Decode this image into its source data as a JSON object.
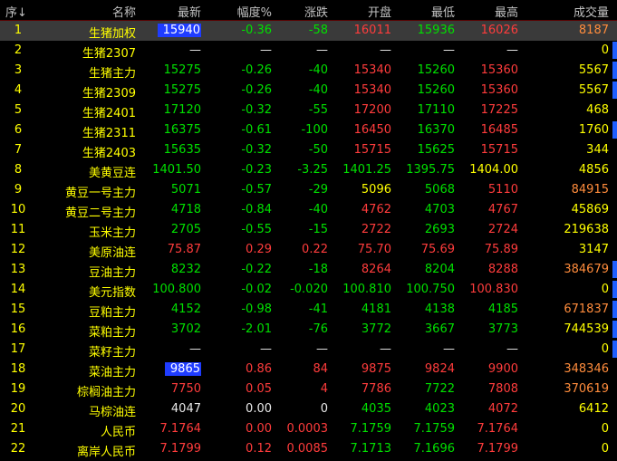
{
  "header": {
    "idx": "序",
    "sort_arrow": "↓",
    "name": "名称",
    "last": "最新",
    "pct": "幅度%",
    "chg": "涨跌",
    "open": "开盘",
    "low": "最低",
    "high": "最高",
    "vol": "成交量"
  },
  "colors": {
    "up": "#ff3c3c",
    "down": "#00e000",
    "flat": "#e8e8e8",
    "name": "#ffff00",
    "highlight": "#1f3cff",
    "bar": "#1f5fff"
  },
  "rows": [
    {
      "idx": "1",
      "name": "生猪加权",
      "last": "15940",
      "pct": "-0.36",
      "chg": "-58",
      "open": "16011",
      "low": "15936",
      "high": "16026",
      "vol": "8187",
      "last_c": "w",
      "pct_c": "g",
      "chg_c": "g",
      "open_c": "r",
      "low_c": "g",
      "high_c": "r",
      "vol_c": "o",
      "sel": true,
      "hl": true,
      "bar": false
    },
    {
      "idx": "2",
      "name": "生猪2307",
      "last": "—",
      "pct": "—",
      "chg": "—",
      "open": "—",
      "low": "—",
      "high": "—",
      "vol": "0",
      "last_c": "w",
      "pct_c": "w",
      "chg_c": "w",
      "open_c": "w",
      "low_c": "w",
      "high_c": "w",
      "vol_c": "y",
      "bar": true
    },
    {
      "idx": "3",
      "name": "生猪主力",
      "last": "15275",
      "pct": "-0.26",
      "chg": "-40",
      "open": "15340",
      "low": "15260",
      "high": "15360",
      "vol": "5567",
      "last_c": "g",
      "pct_c": "g",
      "chg_c": "g",
      "open_c": "r",
      "low_c": "g",
      "high_c": "r",
      "vol_c": "y",
      "bar": true
    },
    {
      "idx": "4",
      "name": "生猪2309",
      "last": "15275",
      "pct": "-0.26",
      "chg": "-40",
      "open": "15340",
      "low": "15260",
      "high": "15360",
      "vol": "5567",
      "last_c": "g",
      "pct_c": "g",
      "chg_c": "g",
      "open_c": "r",
      "low_c": "g",
      "high_c": "r",
      "vol_c": "y",
      "bar": true
    },
    {
      "idx": "5",
      "name": "生猪2401",
      "last": "17120",
      "pct": "-0.32",
      "chg": "-55",
      "open": "17200",
      "low": "17110",
      "high": "17225",
      "vol": "468",
      "last_c": "g",
      "pct_c": "g",
      "chg_c": "g",
      "open_c": "r",
      "low_c": "g",
      "high_c": "r",
      "vol_c": "y",
      "bar": false
    },
    {
      "idx": "6",
      "name": "生猪2311",
      "last": "16375",
      "pct": "-0.61",
      "chg": "-100",
      "open": "16450",
      "low": "16370",
      "high": "16485",
      "vol": "1760",
      "last_c": "g",
      "pct_c": "g",
      "chg_c": "g",
      "open_c": "r",
      "low_c": "g",
      "high_c": "r",
      "vol_c": "y",
      "bar": true
    },
    {
      "idx": "7",
      "name": "生猪2403",
      "last": "15635",
      "pct": "-0.32",
      "chg": "-50",
      "open": "15715",
      "low": "15625",
      "high": "15715",
      "vol": "344",
      "last_c": "g",
      "pct_c": "g",
      "chg_c": "g",
      "open_c": "r",
      "low_c": "g",
      "high_c": "r",
      "vol_c": "y",
      "bar": false
    },
    {
      "idx": "8",
      "name": "美黄豆连",
      "last": "1401.50",
      "pct": "-0.23",
      "chg": "-3.25",
      "open": "1401.25",
      "low": "1395.75",
      "high": "1404.00",
      "vol": "4856",
      "last_c": "g",
      "pct_c": "g",
      "chg_c": "g",
      "open_c": "g",
      "low_c": "g",
      "high_c": "y",
      "vol_c": "y",
      "bar": false
    },
    {
      "idx": "9",
      "name": "黄豆一号主力",
      "last": "5071",
      "pct": "-0.57",
      "chg": "-29",
      "open": "5096",
      "low": "5068",
      "high": "5110",
      "vol": "84915",
      "last_c": "g",
      "pct_c": "g",
      "chg_c": "g",
      "open_c": "y",
      "low_c": "g",
      "high_c": "r",
      "vol_c": "o",
      "bar": false
    },
    {
      "idx": "10",
      "name": "黄豆二号主力",
      "last": "4718",
      "pct": "-0.84",
      "chg": "-40",
      "open": "4762",
      "low": "4703",
      "high": "4767",
      "vol": "45869",
      "last_c": "g",
      "pct_c": "g",
      "chg_c": "g",
      "open_c": "r",
      "low_c": "g",
      "high_c": "r",
      "vol_c": "y",
      "bar": false
    },
    {
      "idx": "11",
      "name": "玉米主力",
      "last": "2705",
      "pct": "-0.55",
      "chg": "-15",
      "open": "2722",
      "low": "2693",
      "high": "2724",
      "vol": "219638",
      "last_c": "g",
      "pct_c": "g",
      "chg_c": "g",
      "open_c": "r",
      "low_c": "g",
      "high_c": "r",
      "vol_c": "y",
      "bar": false
    },
    {
      "idx": "12",
      "name": "美原油连",
      "last": "75.87",
      "pct": "0.29",
      "chg": "0.22",
      "open": "75.70",
      "low": "75.69",
      "high": "75.89",
      "vol": "3147",
      "last_c": "r",
      "pct_c": "r",
      "chg_c": "r",
      "open_c": "r",
      "low_c": "r",
      "high_c": "r",
      "vol_c": "y",
      "bar": false
    },
    {
      "idx": "13",
      "name": "豆油主力",
      "last": "8232",
      "pct": "-0.22",
      "chg": "-18",
      "open": "8264",
      "low": "8204",
      "high": "8288",
      "vol": "384679",
      "last_c": "g",
      "pct_c": "g",
      "chg_c": "g",
      "open_c": "r",
      "low_c": "g",
      "high_c": "r",
      "vol_c": "o",
      "bar": true
    },
    {
      "idx": "14",
      "name": "美元指数",
      "last": "100.800",
      "pct": "-0.02",
      "chg": "-0.020",
      "open": "100.810",
      "low": "100.750",
      "high": "100.830",
      "vol": "0",
      "last_c": "g",
      "pct_c": "g",
      "chg_c": "g",
      "open_c": "g",
      "low_c": "g",
      "high_c": "r",
      "vol_c": "y",
      "bar": true
    },
    {
      "idx": "15",
      "name": "豆粕主力",
      "last": "4152",
      "pct": "-0.98",
      "chg": "-41",
      "open": "4181",
      "low": "4138",
      "high": "4185",
      "vol": "671837",
      "last_c": "g",
      "pct_c": "g",
      "chg_c": "g",
      "open_c": "g",
      "low_c": "g",
      "high_c": "g",
      "vol_c": "o",
      "bar": true
    },
    {
      "idx": "16",
      "name": "菜粕主力",
      "last": "3702",
      "pct": "-2.01",
      "chg": "-76",
      "open": "3772",
      "low": "3667",
      "high": "3773",
      "vol": "744539",
      "last_c": "g",
      "pct_c": "g",
      "chg_c": "g",
      "open_c": "g",
      "low_c": "g",
      "high_c": "g",
      "vol_c": "y",
      "bar": true
    },
    {
      "idx": "17",
      "name": "菜籽主力",
      "last": "—",
      "pct": "—",
      "chg": "—",
      "open": "—",
      "low": "—",
      "high": "—",
      "vol": "0",
      "last_c": "w",
      "pct_c": "w",
      "chg_c": "w",
      "open_c": "w",
      "low_c": "w",
      "high_c": "w",
      "vol_c": "y",
      "bar": true
    },
    {
      "idx": "18",
      "name": "菜油主力",
      "last": "9865",
      "pct": "0.86",
      "chg": "84",
      "open": "9875",
      "low": "9824",
      "high": "9900",
      "vol": "348346",
      "last_c": "w",
      "pct_c": "r",
      "chg_c": "r",
      "open_c": "r",
      "low_c": "r",
      "high_c": "r",
      "vol_c": "o",
      "hl": true,
      "bar": false
    },
    {
      "idx": "19",
      "name": "棕榈油主力",
      "last": "7750",
      "pct": "0.05",
      "chg": "4",
      "open": "7786",
      "low": "7722",
      "high": "7808",
      "vol": "370619",
      "last_c": "r",
      "pct_c": "r",
      "chg_c": "r",
      "open_c": "r",
      "low_c": "g",
      "high_c": "r",
      "vol_c": "o",
      "bar": false
    },
    {
      "idx": "20",
      "name": "马棕油连",
      "last": "4047",
      "pct": "0.00",
      "chg": "0",
      "open": "4035",
      "low": "4023",
      "high": "4072",
      "vol": "6412",
      "last_c": "w",
      "pct_c": "w",
      "chg_c": "w",
      "open_c": "g",
      "low_c": "g",
      "high_c": "r",
      "vol_c": "y",
      "bar": false
    },
    {
      "idx": "21",
      "name": "人民币",
      "last": "7.1764",
      "pct": "0.00",
      "chg": "0.0003",
      "open": "7.1759",
      "low": "7.1759",
      "high": "7.1764",
      "vol": "0",
      "last_c": "r",
      "pct_c": "r",
      "chg_c": "r",
      "open_c": "g",
      "low_c": "g",
      "high_c": "r",
      "vol_c": "y",
      "bar": false
    },
    {
      "idx": "22",
      "name": "离岸人民币",
      "last": "7.1799",
      "pct": "0.12",
      "chg": "0.0085",
      "open": "7.1713",
      "low": "7.1696",
      "high": "7.1799",
      "vol": "0",
      "last_c": "r",
      "pct_c": "r",
      "chg_c": "r",
      "open_c": "g",
      "low_c": "g",
      "high_c": "r",
      "vol_c": "y",
      "bar": false
    }
  ]
}
